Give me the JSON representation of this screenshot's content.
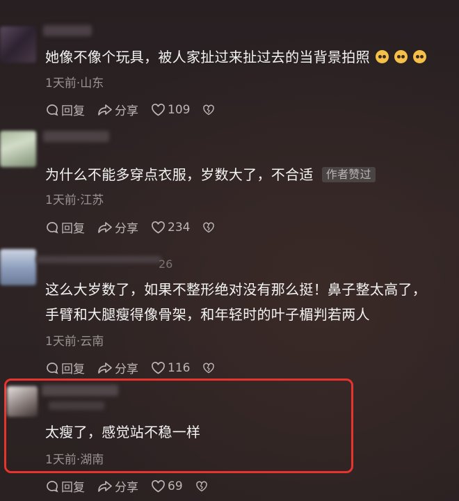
{
  "comments": [
    {
      "text": "她像不像个玩具，被人家扯过来扯过去的当背景拍照",
      "emoji_count": 3,
      "emoji_icon": "pleading-face-icon",
      "meta": "1天前·山东",
      "reply_label": "回复",
      "share_label": "分享",
      "likes": "109"
    },
    {
      "text": "为什么不能多穿点衣服，岁数大了，不合适",
      "badge": "作者赞过",
      "meta": "1天前·江苏",
      "reply_label": "回复",
      "share_label": "分享",
      "likes": "234"
    },
    {
      "username_fragment": "26",
      "text_line1": "这么大岁数了，如果不整形绝对没有那么挺！鼻子整太高了，",
      "text_line2": "手臂和大腿瘦得像骨架，和年轻时的叶子楣判若两人",
      "meta": "1天前·云南",
      "reply_label": "回复",
      "share_label": "分享",
      "likes": "116"
    },
    {
      "text": "太瘦了，感觉站不稳一样",
      "meta": "1天前·湖南",
      "reply_label": "回复",
      "share_label": "分享",
      "likes": "69"
    }
  ],
  "colors": {
    "background": "#2c2324",
    "highlight_border": "#e8342d",
    "meta_text": "#9a9393"
  }
}
